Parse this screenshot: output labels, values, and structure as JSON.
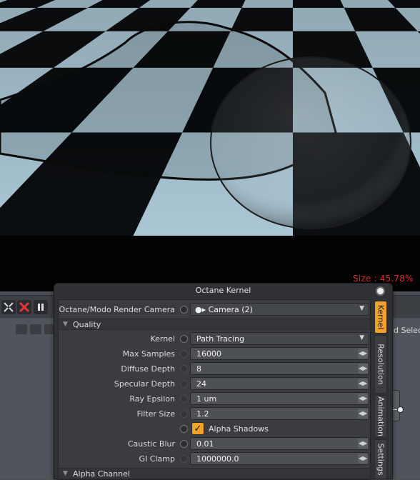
{
  "viewport": {
    "size_readout": "Size : 45.78%"
  },
  "host": {
    "right_text": "dd Selec"
  },
  "panel": {
    "title": "Octane Kernel",
    "camera": {
      "label": "Octane/Modo Render Camera",
      "value": "Camera (2)"
    },
    "quality_section": "Quality",
    "fields": {
      "kernel": {
        "label": "Kernel",
        "value": "Path Tracing"
      },
      "max_samples": {
        "label": "Max Samples",
        "value": "16000"
      },
      "diffuse_depth": {
        "label": "Diffuse Depth",
        "value": "8"
      },
      "specular_depth": {
        "label": "Specular Depth",
        "value": "24"
      },
      "ray_epsilon": {
        "label": "Ray Epsilon",
        "value": "1 um"
      },
      "filter_size": {
        "label": "Filter Size",
        "value": "1.2"
      },
      "alpha_shadows": {
        "label": "Alpha Shadows",
        "checked": true
      },
      "caustic_blur": {
        "label": "Caustic Blur",
        "value": "0.01"
      },
      "gi_clamp": {
        "label": "GI Clamp",
        "value": "1000000.0"
      }
    },
    "alpha_section": "Alpha Channel",
    "tabs": [
      "Kernel",
      "Resolution",
      "Animation",
      "Settings"
    ],
    "active_tab": "Kernel"
  },
  "colors": {
    "accent": "#f3a12b",
    "size_readout": "#e02a2a"
  }
}
